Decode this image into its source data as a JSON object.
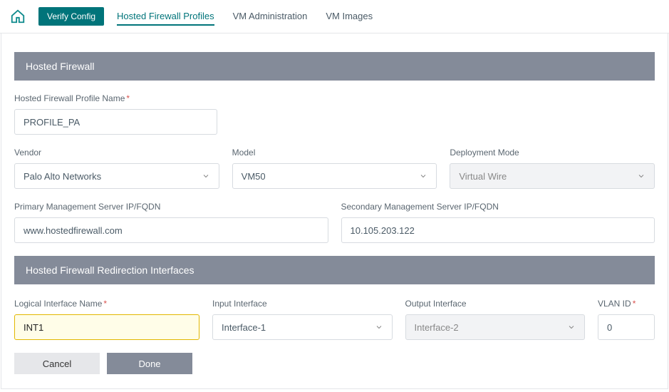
{
  "topbar": {
    "verify_label": "Verify Config",
    "tabs": [
      {
        "label": "Hosted Firewall Profiles",
        "active": true
      },
      {
        "label": "VM Administration",
        "active": false
      },
      {
        "label": "VM Images",
        "active": false
      }
    ]
  },
  "section1": {
    "title": "Hosted Firewall",
    "profile_name_label": "Hosted Firewall Profile Name",
    "profile_name_value": "PROFILE_PA",
    "vendor_label": "Vendor",
    "vendor_value": "Palo Alto Networks",
    "model_label": "Model",
    "model_value": "VM50",
    "deploy_label": "Deployment Mode",
    "deploy_value": "Virtual Wire",
    "primary_label": "Primary Management Server IP/FQDN",
    "primary_value": "www.hostedfirewall.com",
    "secondary_label": "Secondary Management Server IP/FQDN",
    "secondary_value": "10.105.203.122"
  },
  "section2": {
    "title": "Hosted Firewall Redirection Interfaces",
    "logical_label": "Logical Interface Name",
    "logical_value": "INT1",
    "input_if_label": "Input Interface",
    "input_if_value": "Interface-1",
    "output_if_label": "Output Interface",
    "output_if_value": "Interface-2",
    "vlan_label": "VLAN ID",
    "vlan_value": "0",
    "cancel_label": "Cancel",
    "done_label": "Done"
  }
}
